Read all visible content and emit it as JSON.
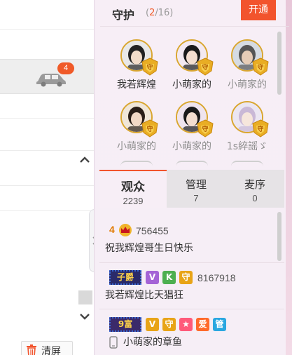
{
  "left": {
    "car_badge": "4",
    "clear_label": "清屏"
  },
  "guard": {
    "title": "守护",
    "count_open": "(",
    "count_current": "2",
    "count_rest": "/16)",
    "open_button": "开通",
    "members": [
      {
        "name": "我若辉煌",
        "dim": false
      },
      {
        "name": "小萌家的",
        "dim": false
      },
      {
        "name": "小萌家的",
        "dim": true
      },
      {
        "name": "小萌家的",
        "dim": true
      },
      {
        "name": "小萌家的",
        "dim": true
      },
      {
        "name": "1s綷謡ゞ",
        "dim": true
      }
    ]
  },
  "tabs": [
    {
      "label": "观众",
      "count": "2239"
    },
    {
      "label": "管理",
      "count": "7"
    },
    {
      "label": "麦序",
      "count": "0"
    }
  ],
  "chat": [
    {
      "level": "4",
      "uid": "756455",
      "text": "祝我辉煌哥生日快乐"
    },
    {
      "title": "子爵",
      "tags": [
        "V",
        "K",
        "守"
      ],
      "uid": "8167918",
      "text": "我若辉煌比天猖狂"
    },
    {
      "title": "9富",
      "tags": [
        "V",
        "守",
        "★",
        "爱",
        "管"
      ],
      "text": "小萌家的章鱼"
    }
  ],
  "colors": {
    "accent": "#f2542d",
    "guard_gold": "#d9a630"
  }
}
